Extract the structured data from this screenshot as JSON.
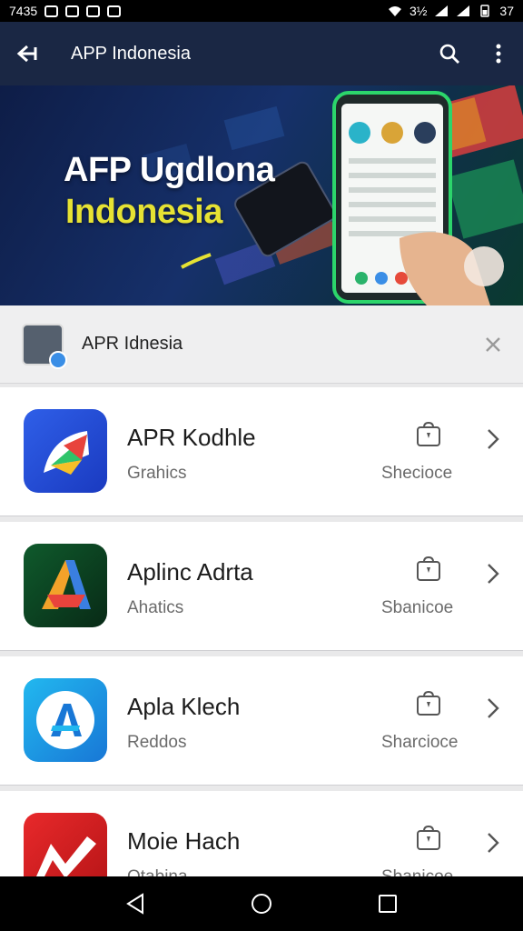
{
  "status_bar": {
    "time": "7435",
    "battery_pct": "3½",
    "clock_right": "37"
  },
  "app_bar": {
    "title": "APP Indonesia"
  },
  "banner": {
    "title_line1": "AFP Ugdlona",
    "title_line2": "Indonesia"
  },
  "notice": {
    "text": "APR Idnesia"
  },
  "apps": [
    {
      "name": "APR Kodhle",
      "category": "Grahics",
      "store_label": "Shecioce"
    },
    {
      "name": "Aplinc Adrta",
      "category": "Ahatics",
      "store_label": "Sbanicoe"
    },
    {
      "name": "Apla Klech",
      "category": "Reddos",
      "store_label": "Sharcioce"
    },
    {
      "name": "Moie Hach",
      "category": "Otabina",
      "store_label": "Sbanicoe"
    }
  ],
  "colors": {
    "app_bar": "#1a2744",
    "banner_accent": "#e6e233",
    "list_bg": "#ffffff"
  }
}
